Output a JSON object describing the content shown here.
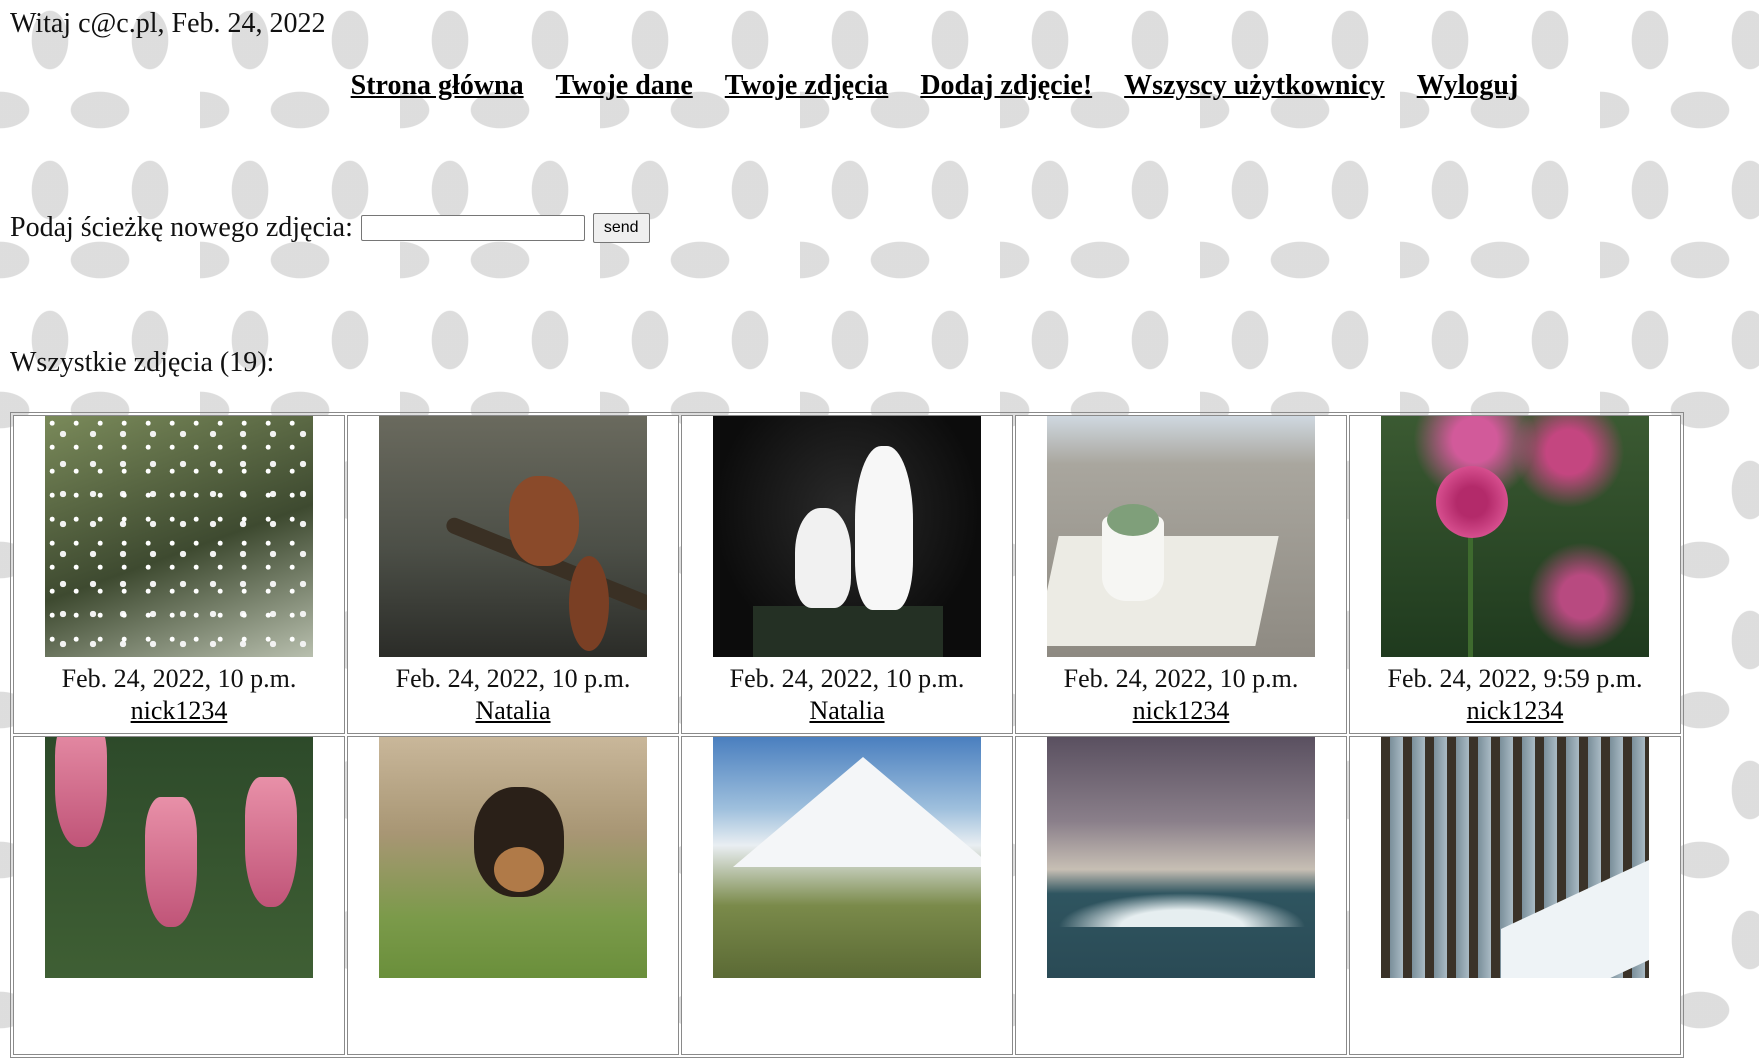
{
  "header": {
    "greeting": "Witaj c@c.pl, Feb. 24, 2022"
  },
  "nav": {
    "items": [
      {
        "label": "Strona główna"
      },
      {
        "label": "Twoje dane"
      },
      {
        "label": "Twoje zdjęcia"
      },
      {
        "label": "Dodaj zdjęcie!"
      },
      {
        "label": "Wszyscy użytkownicy"
      },
      {
        "label": "Wyloguj"
      }
    ]
  },
  "upload_form": {
    "label": "Podaj ścieżkę nowego zdjęcia:",
    "input_value": "",
    "submit_label": "send"
  },
  "gallery": {
    "heading": "Wszystkie zdjęcia (19):",
    "photos": [
      {
        "date": "Feb. 24, 2022, 10 p.m.",
        "user": "nick1234",
        "subject": "white-blossoms"
      },
      {
        "date": "Feb. 24, 2022, 10 p.m.",
        "user": "Natalia",
        "subject": "squirrel"
      },
      {
        "date": "Feb. 24, 2022, 10 p.m.",
        "user": "Natalia",
        "subject": "kittens"
      },
      {
        "date": "Feb. 24, 2022, 10 p.m.",
        "user": "nick1234",
        "subject": "succulent-on-book"
      },
      {
        "date": "Feb. 24, 2022, 9:59 p.m.",
        "user": "nick1234",
        "subject": "pink-flower"
      },
      {
        "subject": "tulips"
      },
      {
        "subject": "puppy"
      },
      {
        "subject": "mountains"
      },
      {
        "subject": "sea-waves"
      },
      {
        "subject": "snowy-forest"
      }
    ]
  }
}
